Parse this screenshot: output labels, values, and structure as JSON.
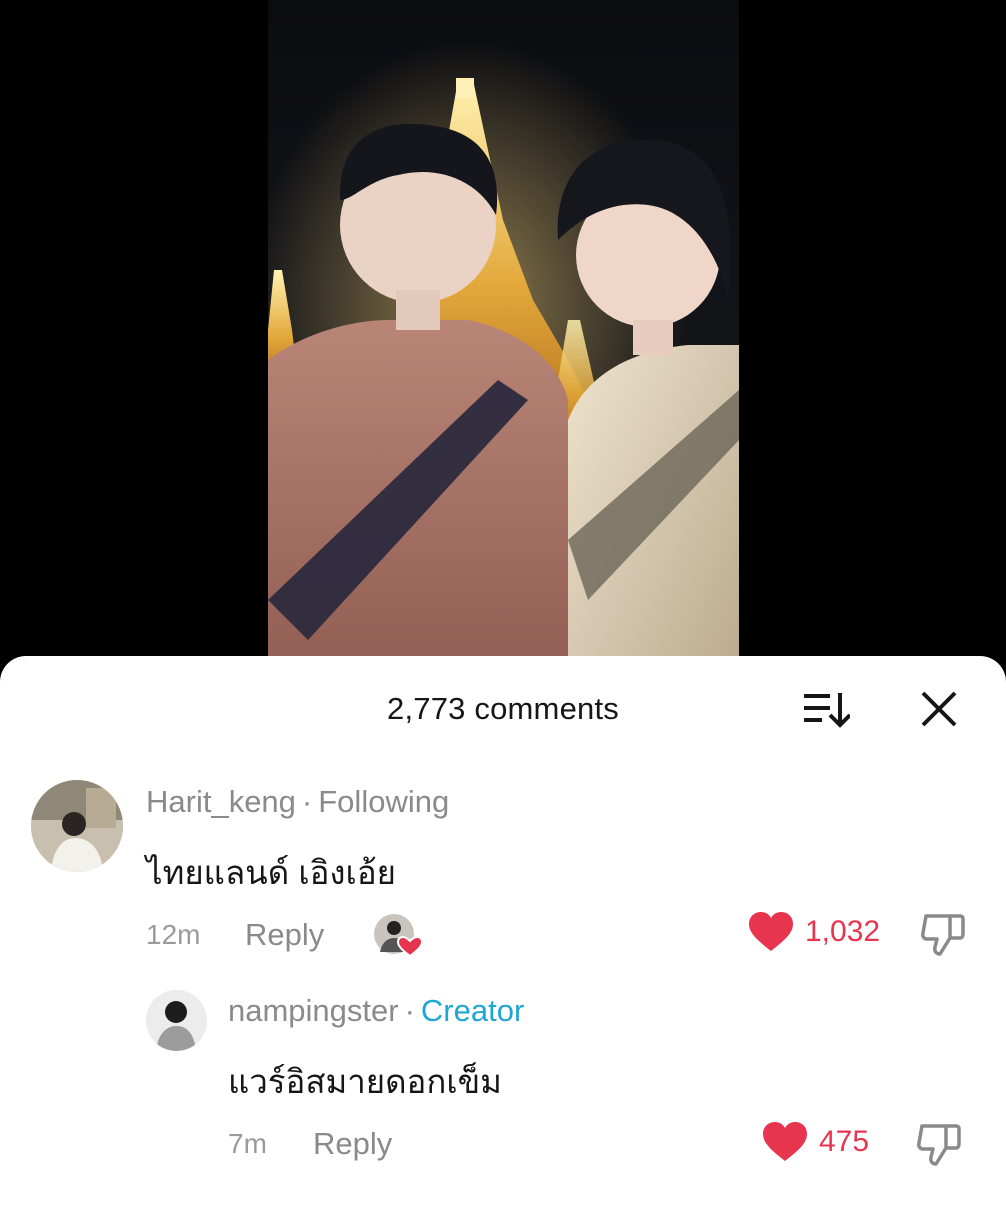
{
  "header": {
    "comment_count": "2,773 comments"
  },
  "icons": {
    "sort": "sort-icon",
    "close": "close-icon",
    "like": "heart-icon",
    "dislike": "thumbs-down-icon"
  },
  "colors": {
    "like": "#e8354f",
    "creator": "#1fa7d3",
    "muted": "#8a8a8a"
  },
  "comments": [
    {
      "username": "Harit_keng",
      "separator": "·",
      "badge": "Following",
      "text": "ไทยแลนด์ เอิงเอ้ย",
      "time": "12m",
      "reply_label": "Reply",
      "likes": "1,032",
      "liked_by_creator": true
    },
    {
      "username": "nampingster",
      "separator": "·",
      "badge": "Creator",
      "text": "แวร์อิสมายดอกเข็ม",
      "time": "7m",
      "reply_label": "Reply",
      "likes": "475"
    }
  ]
}
